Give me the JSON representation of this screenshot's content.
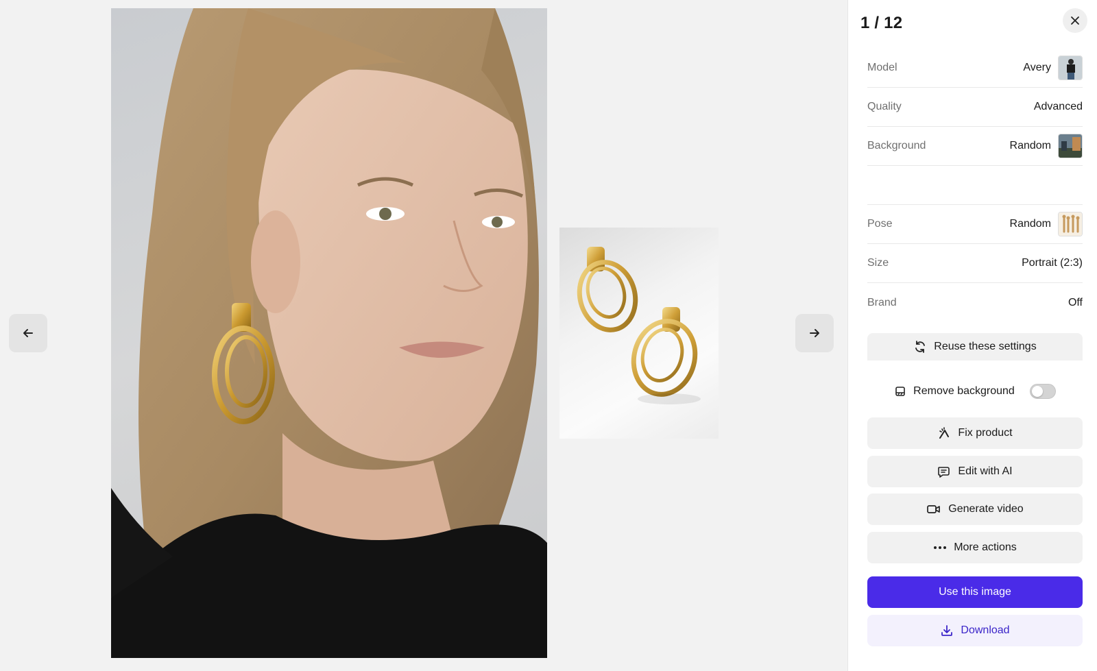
{
  "viewer": {
    "prev_icon": "arrow-left-icon",
    "next_icon": "arrow-right-icon"
  },
  "panel": {
    "counter": "1 / 12",
    "close_icon": "close-icon",
    "settings": [
      {
        "label": "Model",
        "value": "Avery",
        "thumb": "model-thumbnail"
      },
      {
        "label": "Quality",
        "value": "Advanced"
      },
      {
        "label": "Background",
        "value": "Random",
        "thumb": "background-thumbnail"
      },
      {
        "label": "Pose",
        "value": "Random",
        "thumb": "pose-thumbnail"
      },
      {
        "label": "Size",
        "value": "Portrait (2:3)"
      },
      {
        "label": "Brand",
        "value": "Off"
      }
    ],
    "reuse_label": "Reuse these settings",
    "remove_bg_label": "Remove background",
    "remove_bg_enabled": false,
    "fix_label": "Fix product",
    "edit_label": "Edit with AI",
    "video_label": "Generate video",
    "more_label": "More actions",
    "use_label": "Use this image",
    "download_label": "Download"
  },
  "colors": {
    "primary": "#4a2be8",
    "download_text": "#3b25c9",
    "download_bg": "#f3f1fd"
  }
}
